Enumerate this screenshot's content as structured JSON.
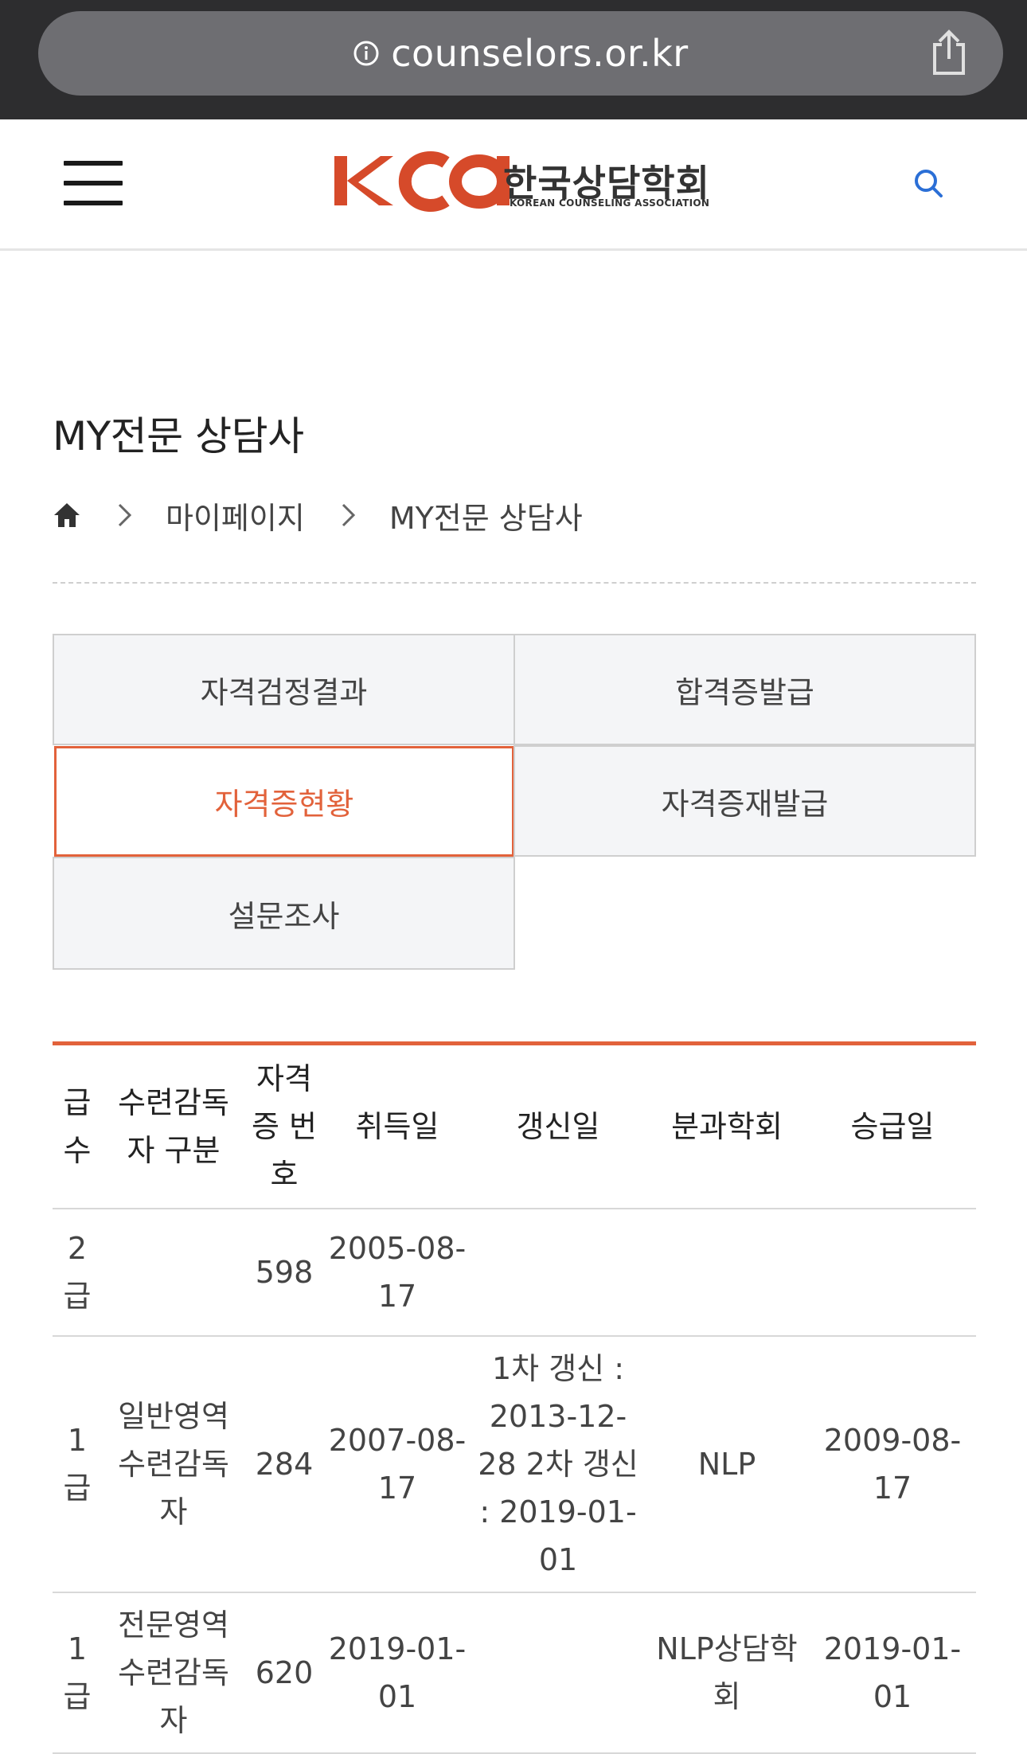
{
  "browser": {
    "url": "counselors.or.kr"
  },
  "header": {
    "logo_mark": "KCA",
    "logo_korean": "한국상담학회",
    "logo_english": "KOREAN COUNSELING ASSOCIATION"
  },
  "page": {
    "title": "MY전문 상담사",
    "breadcrumb": [
      "마이페이지",
      "MY전문 상담사"
    ]
  },
  "menu": {
    "items": [
      {
        "label": "자격검정결과",
        "active": false
      },
      {
        "label": "합격증발급",
        "active": false
      },
      {
        "label": "자격증현황",
        "active": true
      },
      {
        "label": "자격증재발급",
        "active": false
      },
      {
        "label": "설문조사",
        "active": false
      }
    ]
  },
  "table": {
    "headers": [
      "급수",
      "수련감독자 구분",
      "자격증 번호",
      "취득일",
      "갱신일",
      "분과학회",
      "승급일"
    ],
    "rows": [
      {
        "grade": "2급",
        "supervisor": "",
        "number": "598",
        "acquired": "2005-08-17",
        "renewal": "",
        "division": "",
        "promoted": ""
      },
      {
        "grade": "1급",
        "supervisor": "일반영역 수련감독자",
        "number": "284",
        "acquired": "2007-08-17",
        "renewal": "1차 갱신 : 2013-12-28 2차 갱신 : 2019-01-01",
        "division": "NLP",
        "promoted": "2009-08-17"
      },
      {
        "grade": "1급",
        "supervisor": "전문영역 수련감독자",
        "number": "620",
        "acquired": "2019-01-01",
        "renewal": "",
        "division": "NLP상담학회",
        "promoted": "2019-01-01"
      }
    ]
  },
  "colors": {
    "accent": "#e2623b",
    "browser_bar": "#2d2d2f",
    "url_pill": "#6e6e72",
    "search_icon": "#2b6fd6"
  },
  "icons": [
    "info-icon",
    "share-icon",
    "hamburger-menu-icon",
    "search-icon",
    "home-icon",
    "chevron-right-icon"
  ]
}
